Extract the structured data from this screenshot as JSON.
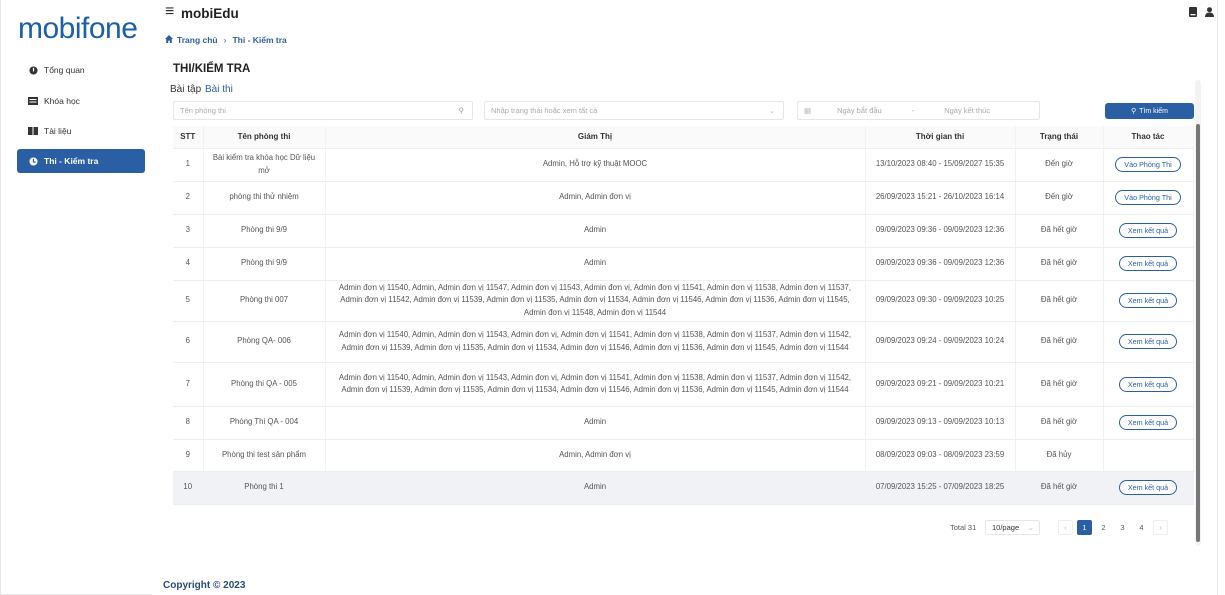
{
  "brand": {
    "logo_text": "mobifone",
    "app_title": "mobiEdu",
    "accent": "#2b5fa3",
    "logo_color": "#1a5fa8"
  },
  "sidebar": {
    "items": [
      {
        "label": "Tổng quan",
        "icon": "dashboard-icon"
      },
      {
        "label": "Khóa học",
        "icon": "course-icon"
      },
      {
        "label": "Tài liệu",
        "icon": "document-icon"
      },
      {
        "label": "Thi - Kiểm tra",
        "icon": "exam-icon",
        "active": true
      }
    ]
  },
  "breadcrumb": {
    "home": "Trang chủ",
    "current": "Thi - Kiểm tra"
  },
  "header": {
    "icons": [
      "book-icon",
      "user-icon"
    ]
  },
  "page": {
    "title": "THI/KIỂM TRA"
  },
  "tabs": [
    {
      "label": "Bài tập"
    },
    {
      "label": "Bài thi",
      "active": true
    }
  ],
  "filters": {
    "room_placeholder": "Tên phòng thi",
    "status_placeholder": "Nhập trạng thái hoặc xem tất cả",
    "start_placeholder": "Ngày bắt đầu",
    "end_placeholder": "Ngày kết thúc",
    "search_label": "Tìm kiếm"
  },
  "table": {
    "columns": [
      "STT",
      "Tên phòng thi",
      "Giám Thị",
      "Thời gian thi",
      "Trạng thái",
      "Thao tác"
    ],
    "rows": [
      {
        "stt": "1",
        "name": "Bài kiểm tra khóa học Dữ liệu mở",
        "proctor": "Admin, Hỗ trợ kỹ thuật MOOC",
        "time": "13/10/2023 08:40 - 15/09/2027 15:35",
        "status": "Đến giờ",
        "action": "Vào Phòng Thi"
      },
      {
        "stt": "2",
        "name": "phòng thi thử nhiệm",
        "proctor": "Admin, Admin đơn vị",
        "time": "26/09/2023 15:21 - 26/10/2023 16:14",
        "status": "Đến giờ",
        "action": "Vào Phòng Thi"
      },
      {
        "stt": "3",
        "name": "Phòng thi 9/9",
        "proctor": "Admin",
        "time": "09/09/2023 09:36 - 09/09/2023 12:36",
        "status": "Đã hết giờ",
        "action": "Xem kết quả"
      },
      {
        "stt": "4",
        "name": "Phòng thi 9/9",
        "proctor": "Admin",
        "time": "09/09/2023 09:36 - 09/09/2023 12:36",
        "status": "Đã hết giờ",
        "action": "Xem kết quả"
      },
      {
        "stt": "5",
        "name": "Phòng thi 007",
        "proctor": "Admin đơn vị 11540, Admin, Admin đơn vị 11547, Admin đơn vị 11543, Admin đơn vị, Admin đơn vị 11541, Admin đơn vị 11538, Admin đơn vị 11537, Admin đơn vị 11542, Admin đơn vị 11539, Admin đơn vị 11535, Admin đơn vị 11534, Admin đơn vị 11546, Admin đơn vị 11536, Admin đơn vị 11545, Admin đơn vị 11548, Admin đơn vị 11544",
        "time": "09/09/2023 09:30 - 09/09/2023 10:25",
        "status": "Đã hết giờ",
        "action": "Xem kết quả"
      },
      {
        "stt": "6",
        "name": "Phòng QA- 006",
        "proctor": "Admin đơn vị 11540, Admin, Admin đơn vị 11543, Admin đơn vị, Admin đơn vị 11541, Admin đơn vị 11538, Admin đơn vị 11537, Admin đơn vị 11542, Admin đơn vị 11539, Admin đơn vị 11535, Admin đơn vị 11534, Admin đơn vị 11546, Admin đơn vị 11536, Admin đơn vị 11545, Admin đơn vị 11544",
        "time": "09/09/2023 09:24 - 09/09/2023 10:24",
        "status": "Đã hết giờ",
        "action": "Xem kết quả"
      },
      {
        "stt": "7",
        "name": "Phòng thi QA - 005",
        "proctor": "Admin đơn vị 11540, Admin, Admin đơn vị 11543, Admin đơn vị, Admin đơn vị 11541, Admin đơn vị 11538, Admin đơn vị 11537, Admin đơn vị 11542, Admin đơn vị 11539, Admin đơn vị 11535, Admin đơn vị 11534, Admin đơn vị 11546, Admin đơn vị 11536, Admin đơn vị 11545, Admin đơn vị 11544",
        "time": "09/09/2023 09:21 - 09/09/2023 10:21",
        "status": "Đã hết giờ",
        "action": "Xem kết quả"
      },
      {
        "stt": "8",
        "name": "Phòng Thi QA - 004",
        "proctor": "Admin",
        "time": "09/09/2023 09:13 - 09/09/2023 10:13",
        "status": "Đã hết giờ",
        "action": "Xem kết quả"
      },
      {
        "stt": "9",
        "name": "Phòng thi test sản phẩm",
        "proctor": "Admin, Admin đơn vị",
        "time": "08/09/2023 09:03 - 08/09/2023 23:59",
        "status": "Đã hủy",
        "action": ""
      },
      {
        "stt": "10",
        "name": "Phòng thi 1",
        "proctor": "Admin",
        "time": "07/09/2023 15:25 - 07/09/2023 18:25",
        "status": "Đã hết giờ",
        "action": "Xem kết quả",
        "highlight": true
      }
    ]
  },
  "pagination": {
    "total": "Total 31",
    "page_size": "10/page",
    "pages": [
      "1",
      "2",
      "3",
      "4"
    ],
    "current": "1"
  },
  "footer": {
    "copyright": "Copyright © 2023"
  }
}
